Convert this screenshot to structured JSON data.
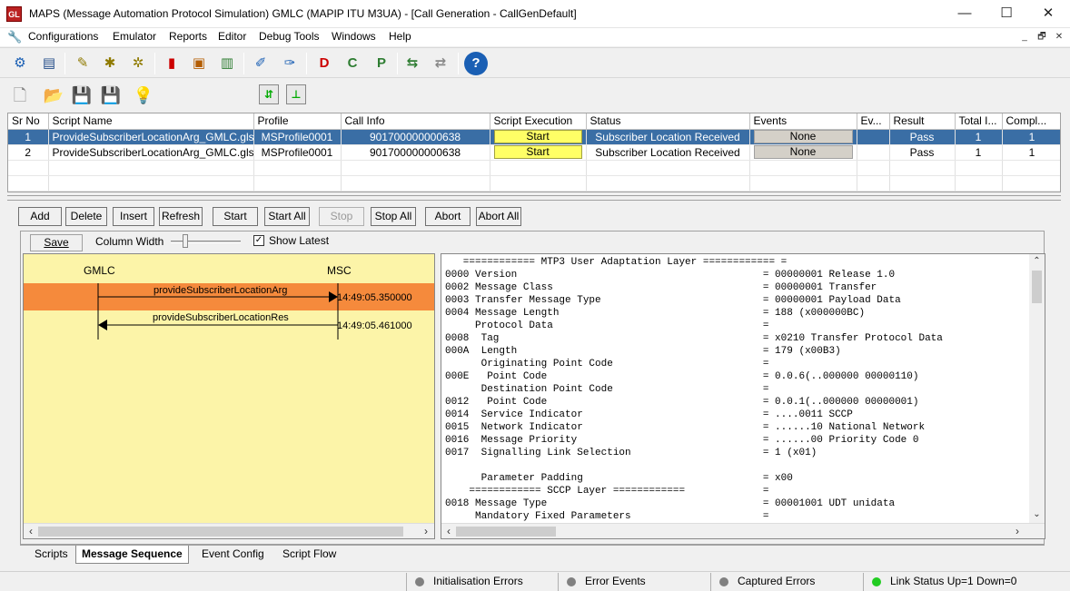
{
  "window": {
    "title": "MAPS (Message Automation Protocol Simulation) GMLC (MAPIP ITU M3UA) - [Call Generation  - CallGenDefault]",
    "app_icon_text": "GL",
    "minimize": "—",
    "maximize": "☐",
    "close": "✕"
  },
  "menu": {
    "items": [
      "Configurations",
      "Emulator",
      "Reports",
      "Editor",
      "Debug Tools",
      "Windows",
      "Help"
    ],
    "mdi_min": "_",
    "mdi_restore": "🗗",
    "mdi_close": "✕"
  },
  "grid": {
    "columns": [
      "Sr No",
      "Script Name",
      "Profile",
      "Call Info",
      "Script Execution",
      "Status",
      "Events",
      "Ev...",
      "Result",
      "Total I...",
      "Compl..."
    ],
    "rows": [
      {
        "srno": "1",
        "script": "ProvideSubscriberLocationArg_GMLC.gls",
        "profile": "MSProfile0001",
        "callinfo": "901700000000638",
        "exec": "Start",
        "status": "Subscriber Location Received",
        "events": "None",
        "ev": "",
        "result": "Pass",
        "total": "1",
        "compl": "1"
      },
      {
        "srno": "2",
        "script": "ProvideSubscriberLocationArg_GMLC.gls",
        "profile": "MSProfile0001",
        "callinfo": "901700000000638",
        "exec": "Start",
        "status": "Subscriber Location Received",
        "events": "None",
        "ev": "",
        "result": "Pass",
        "total": "1",
        "compl": "1"
      }
    ]
  },
  "buttons": {
    "add": "Add",
    "delete": "Delete",
    "insert": "Insert",
    "refresh": "Refresh",
    "start": "Start",
    "start_all": "Start All",
    "stop": "Stop",
    "stop_all": "Stop All",
    "abort": "Abort",
    "abort_all": "Abort All"
  },
  "ladder": {
    "save": "Save",
    "column_width": "Column Width",
    "show_latest": "Show Latest",
    "show_latest_checked": true,
    "left_entity": "GMLC",
    "right_entity": "MSC",
    "messages": [
      {
        "label": "provideSubscriberLocationArg",
        "time": "14:49:05.350000",
        "direction": "right",
        "highlighted": true
      },
      {
        "label": "provideSubscriberLocationRes",
        "time": "14:49:05.461000",
        "direction": "left",
        "highlighted": false
      }
    ]
  },
  "decode_lines": [
    "   ============ MTP3 User Adaptation Layer ============ =",
    "0000 Version                                         = 00000001 Release 1.0",
    "0002 Message Class                                   = 00000001 Transfer",
    "0003 Transfer Message Type                           = 00000001 Payload Data",
    "0004 Message Length                                  = 188 (x000000BC)",
    "     Protocol Data                                   =",
    "0008  Tag                                            = x0210 Transfer Protocol Data",
    "000A  Length                                         = 179 (x00B3)",
    "      Originating Point Code                         =",
    "000E   Point Code                                    = 0.0.6(..000000 00000110)",
    "      Destination Point Code                         =",
    "0012   Point Code                                    = 0.0.1(..000000 00000001)",
    "0014  Service Indicator                              = ....0011 SCCP",
    "0015  Network Indicator                              = ......10 National Network",
    "0016  Message Priority                               = ......00 Priority Code 0",
    "0017  Signalling Link Selection                      = 1 (x01)",
    "",
    "      Parameter Padding                              = x00",
    "    ============ SCCP Layer ============             =",
    "0018 Message Type                                    = 00001001 UDT unidata",
    "     Mandatory Fixed Parameters                      ="
  ],
  "tabs": [
    "Scripts",
    "Message Sequence",
    "Event Config",
    "Script Flow"
  ],
  "active_tab": "Message Sequence",
  "status": [
    {
      "text": "Initialisation Errors",
      "color": "#808080"
    },
    {
      "text": "Error Events",
      "color": "#808080"
    },
    {
      "text": "Captured Errors",
      "color": "#808080"
    },
    {
      "text": "Link Status Up=1 Down=0",
      "color": "#22cc22"
    }
  ],
  "colors": {
    "selected_row": "#3a6ea5",
    "start_cell": "#ffff66",
    "ladder_bg": "#fcf4a8",
    "ladder_highlight": "#f58a3c"
  }
}
